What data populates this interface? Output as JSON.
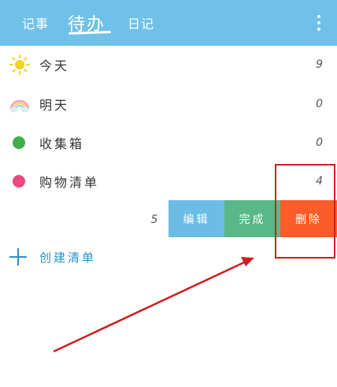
{
  "header": {
    "tabs": [
      {
        "label": "记事"
      },
      {
        "label": "待办"
      },
      {
        "label": "日记"
      }
    ]
  },
  "lists": [
    {
      "label": "今天",
      "count": "9",
      "icon": "sun-icon"
    },
    {
      "label": "明天",
      "count": "0",
      "icon": "rainbow-icon"
    },
    {
      "label": "收集箱",
      "count": "0",
      "icon": "green-dot-icon",
      "color": "#3fae4a"
    },
    {
      "label": "购物清单",
      "count": "4",
      "icon": "pink-dot-icon",
      "color": "#f0457e"
    }
  ],
  "swiped_row": {
    "count": "5",
    "actions": {
      "edit": "编辑",
      "done": "完成",
      "delete": "删除"
    },
    "colors": {
      "edit": "#6cbde6",
      "done": "#58b887",
      "delete": "#fc5c2a"
    }
  },
  "create_list": {
    "label": "创建清单"
  },
  "colors": {
    "header": "#6fc1e8",
    "accent": "#2f8fc9",
    "annotation": "#cc1f1f"
  }
}
